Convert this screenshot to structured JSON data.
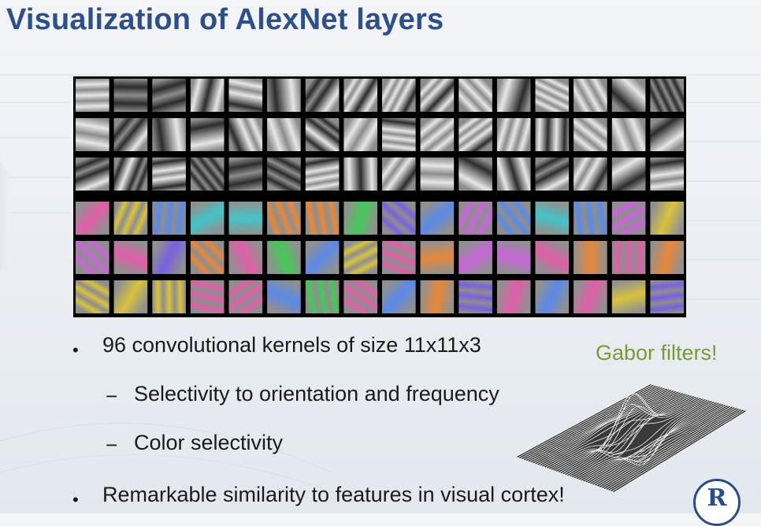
{
  "slide": {
    "title": "Visualization of AlexNet layers",
    "gabor_label": "Gabor filters!",
    "logo_letter": "R",
    "bullets": [
      {
        "level": 1,
        "marker": "•",
        "text": "96 convolutional kernels of size 11x11x3"
      },
      {
        "level": 2,
        "marker": "−",
        "text": "Selectivity to orientation and frequency"
      },
      {
        "level": 2,
        "marker": "−",
        "text": "Color selectivity"
      },
      {
        "level": 1,
        "marker": "•",
        "text": "Remarkable similarity to features in visual cortex!"
      }
    ]
  },
  "kernel_grid": {
    "rows": 6,
    "cols": 16,
    "gray_rows": 3,
    "color_rows": 3
  },
  "colors": {
    "title": "#2e4f8a",
    "gabor_label": "#7a9a3a",
    "logo": "#2a4c8a",
    "frame": "#000000"
  }
}
